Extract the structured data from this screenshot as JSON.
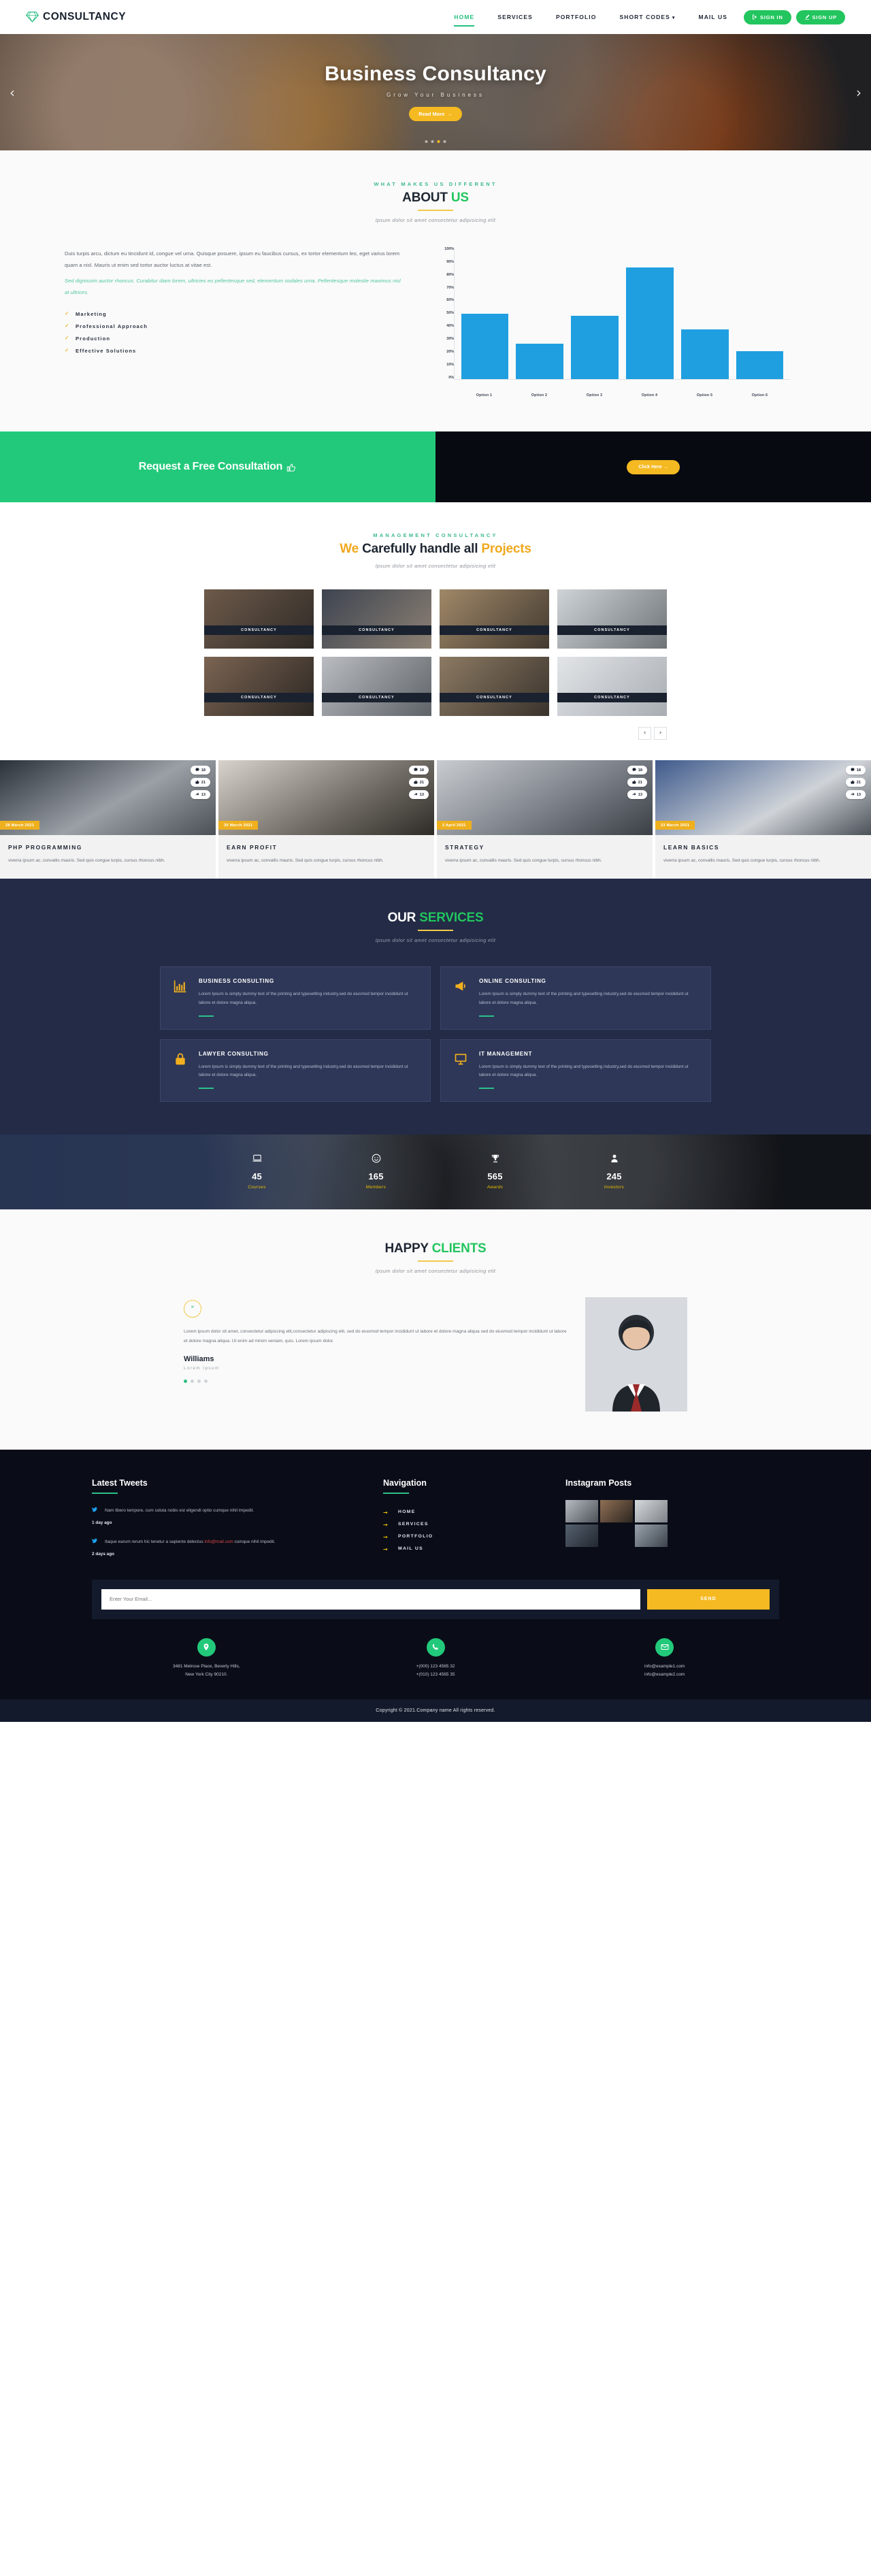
{
  "header": {
    "brand": "CONSULTANCY",
    "brand_icon": "diamond-icon",
    "nav": [
      {
        "label": "HOME",
        "active": true,
        "caret": false
      },
      {
        "label": "SERVICES",
        "active": false,
        "caret": false
      },
      {
        "label": "PORTFOLIO",
        "active": false,
        "caret": false
      },
      {
        "label": "SHORT CODES",
        "active": false,
        "caret": true
      },
      {
        "label": "MAIL US",
        "active": false,
        "caret": false
      }
    ],
    "sign_in": "SIGN IN",
    "sign_up": "SIGN UP",
    "accent": "#22c55e"
  },
  "hero": {
    "title": "Business Consultancy",
    "subtitle": "Grow Your Business",
    "button": "Read More",
    "prev": "‹",
    "next": "›",
    "dots": 4,
    "active_dot": 2
  },
  "about": {
    "eyebrow": "WHAT MAKES US DIFFERENT",
    "title_dark": "ABOUT",
    "title_green": "US",
    "subtitle": "Ipsum dolor sit amet consectetur adipisicing elit",
    "paragraph": "Duis turpis arcu, dictum eu tincidunt id, congue vel urna. Quisque posuere, ipsum eu faucibus cursus, ex tortor elementum leo, eget varius lorem quam a nisl. Mauris ut enim sed tortor auctor luctus at vitae est.",
    "paragraph_accent": "Sed dignissim auctor rhoncus. Curabitur diam lorem, ultricies eu pellentesque sed, elementum sodales urna. Pellentesque molestie maximus nisl at ultrices.",
    "list": [
      "Marketing",
      "Professional Approach",
      "Production",
      "Effective Solutions"
    ]
  },
  "chart_data": {
    "type": "bar",
    "title": "",
    "categories": [
      "Option 1",
      "Option 2",
      "Option 3",
      "Option 4",
      "Option 5",
      "Option 6"
    ],
    "values": [
      50,
      27,
      48,
      85,
      38,
      21
    ],
    "ytick_labels": [
      "0%",
      "10%",
      "20%",
      "30%",
      "40%",
      "50%",
      "60%",
      "70%",
      "80%",
      "90%",
      "100%"
    ],
    "ylim": [
      0,
      100
    ],
    "xlabel": "",
    "ylabel": "",
    "grid": false,
    "legend": false,
    "bar_color": "#1f9fe0"
  },
  "cta": {
    "text": "Request a Free Consultation",
    "icon": "thumbs-up-icon",
    "button": "Click Here",
    "left_bg": "#22c97a",
    "right_bg": "#080a12"
  },
  "projects": {
    "eyebrow": "MANAGEMENT CONSULTANCY",
    "title_pre": "We",
    "title_mid": "Carefully handle all",
    "title_post": "Projects",
    "subtitle": "Ipsum dolor sit amet consectetur adipisicing elit",
    "tag": "CONSULTANCY",
    "items": [
      {
        "tag": "CONSULTANCY"
      },
      {
        "tag": "CONSULTANCY"
      },
      {
        "tag": "CONSULTANCY"
      },
      {
        "tag": "CONSULTANCY"
      },
      {
        "tag": "CONSULTANCY"
      },
      {
        "tag": "CONSULTANCY"
      },
      {
        "tag": "CONSULTANCY"
      },
      {
        "tag": "CONSULTANCY"
      }
    ],
    "prev": "‹",
    "next": "›"
  },
  "blog": {
    "excerpt": "viverra ipsum ac, convallis mauris. Sed quis congue turpis, cursus rhoncus nibh.",
    "posts": [
      {
        "date": "28 March 2021",
        "title": "PHP PROGRAMMING",
        "comments": "18",
        "likes": "21",
        "shares": "13"
      },
      {
        "date": "30 March 2021",
        "title": "EARN PROFIT",
        "comments": "18",
        "likes": "21",
        "shares": "13"
      },
      {
        "date": "2 April 2021",
        "title": "STRATEGY",
        "comments": "18",
        "likes": "21",
        "shares": "13"
      },
      {
        "date": "23 March 2021",
        "title": "LEARN BASICS",
        "comments": "18",
        "likes": "21",
        "shares": "13"
      }
    ]
  },
  "services": {
    "title_light": "OUR",
    "title_green": "SERVICES",
    "subtitle": "Ipsum dolor sit amet consectetur adipisicing elit",
    "body": "Lorem Ipsum is simply dummy text of the printing and typesetting industry,sed do eiusmod tempor incididunt ut labore et dolore magna aliqua.",
    "cards": [
      {
        "title": "BUSINESS CONSULTING",
        "icon": "bar-chart-icon"
      },
      {
        "title": "ONLINE CONSULTING",
        "icon": "megaphone-icon"
      },
      {
        "title": "LAWYER CONSULTING",
        "icon": "lock-icon"
      },
      {
        "title": "IT MANAGEMENT",
        "icon": "monitor-icon"
      }
    ]
  },
  "stats": [
    {
      "icon": "laptop-icon",
      "number": "45",
      "label": "Courses"
    },
    {
      "icon": "smile-icon",
      "number": "165",
      "label": "Members"
    },
    {
      "icon": "trophy-icon",
      "number": "565",
      "label": "Awards"
    },
    {
      "icon": "user-icon",
      "number": "245",
      "label": "Investors"
    }
  ],
  "testimonial": {
    "title_dark": "HAPPY",
    "title_green": "CLIENTS",
    "subtitle": "Ipsum dolor sit amet consectetur adipisicing elit",
    "quote_mark": "“",
    "text": "Lorem ipsum dolor sit amet, consectetur adipiscing elit,consectetur adipiscing elit, sed do eiusmod tempor incididunt ut labore et dolore magna aliqua sed do eiusmod tempor incididunt ut labore et dolore magna aliqua. Ut enim ad minim veniam, quis. Lorem ipsum dolor.",
    "name": "Williams",
    "role": "Lorem Ipsum",
    "dots": 4,
    "active_dot": 0
  },
  "footer": {
    "tweets_heading": "Latest Tweets",
    "tweets": [
      {
        "text": "Nam libero tempore, cum soluta nobis est eligendi optio cumque nihil impedit.",
        "ago": "1 day ago",
        "link": "",
        "link_text": ""
      },
      {
        "text_pre": "Itaque earum rerum hic tenetur a sapiente delectus ",
        "link_text": "info@mail.com",
        "text_post": " cumque nihil impedit.",
        "ago": "2 days ago"
      }
    ],
    "nav_heading": "Navigation",
    "nav": [
      "HOME",
      "SERVICES",
      "PORTFOLIO",
      "MAIL US"
    ],
    "instagram_heading": "Instagram Posts",
    "newsletter_placeholder": "Enter Your Email...",
    "newsletter_button": "SEND",
    "contacts": [
      {
        "icon": "location-icon",
        "line1": "3481 Melrose Place, Beverly Hills,",
        "line2": "New York City 90210."
      },
      {
        "icon": "phone-icon",
        "line1": "+(000) 123 4565 32",
        "line2": "+(010) 123 4565 35"
      },
      {
        "icon": "mail-icon",
        "line1": "info@example1.com",
        "line2": "info@example2.com"
      }
    ],
    "copyright": "Copyright © 2021.Company name All rights reserved."
  }
}
